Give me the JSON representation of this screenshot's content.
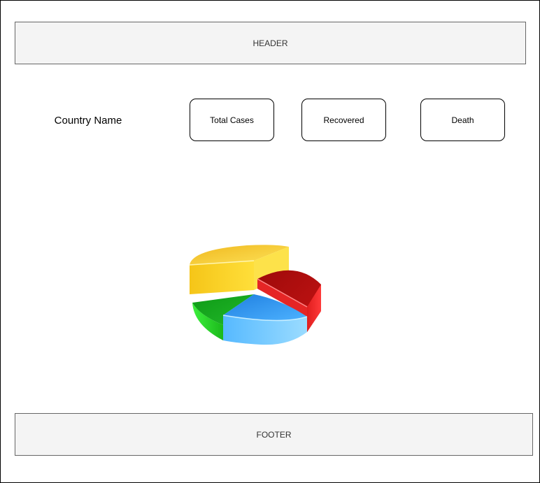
{
  "header": {
    "label": "HEADER"
  },
  "footer": {
    "label": "FOOTER"
  },
  "country": {
    "label": "Country Name"
  },
  "stats": {
    "total_cases": "Total Cases",
    "recovered": "Recovered",
    "death": "Death"
  },
  "pie_icon": {
    "name": "pie-chart-icon",
    "colors": [
      "#f5c518",
      "#c41414",
      "#2e95ee",
      "#2bbf2b"
    ]
  }
}
